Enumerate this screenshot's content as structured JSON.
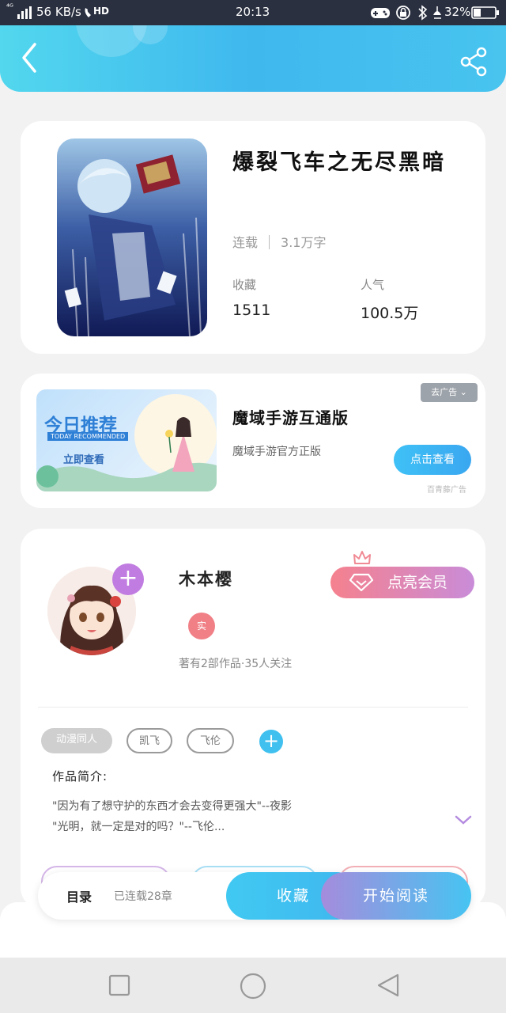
{
  "status_bar": {
    "network": "⁴ᴳ",
    "speed": "56 KB/s",
    "hd": "HD",
    "time": "20:13",
    "battery": "32%"
  },
  "book": {
    "title": "爆裂飞车之无尽黑暗",
    "status": "连载",
    "word_count": "3.1万字",
    "favorites_label": "收藏",
    "favorites_value": "1511",
    "popularity_label": "人气",
    "popularity_value": "100.5万"
  },
  "ad": {
    "banner_title": "今日推荐",
    "banner_subtitle": "TODAY RECOMMENDED",
    "banner_button": "立即查看",
    "close_label": "去广告 ⌄",
    "title": "魔域手游互通版",
    "description": "魔域手游官方正版",
    "cta": "点击查看",
    "source": "百青藤广告"
  },
  "author": {
    "name": "木本樱",
    "verified_label": "实",
    "stats": "著有2部作品·35人关注",
    "vip_button": "点亮会员",
    "tags": [
      "动漫同人",
      "凯飞",
      "飞伦"
    ],
    "intro_label": "作品简介:",
    "intro_line1": "\"因为有了想守护的东西才会去变得更强大\"--夜影",
    "intro_line2": "\"光明，就一定是对的吗？\"--飞伦..."
  },
  "bottom_bar": {
    "toc_label": "目录",
    "toc_status": "已连载28章",
    "collect_button": "收藏",
    "read_button": "开始阅读"
  },
  "colors": {
    "accent_blue": "#3fb6ee",
    "vip_pink": "#f5818e",
    "purple": "#c07ce0"
  }
}
